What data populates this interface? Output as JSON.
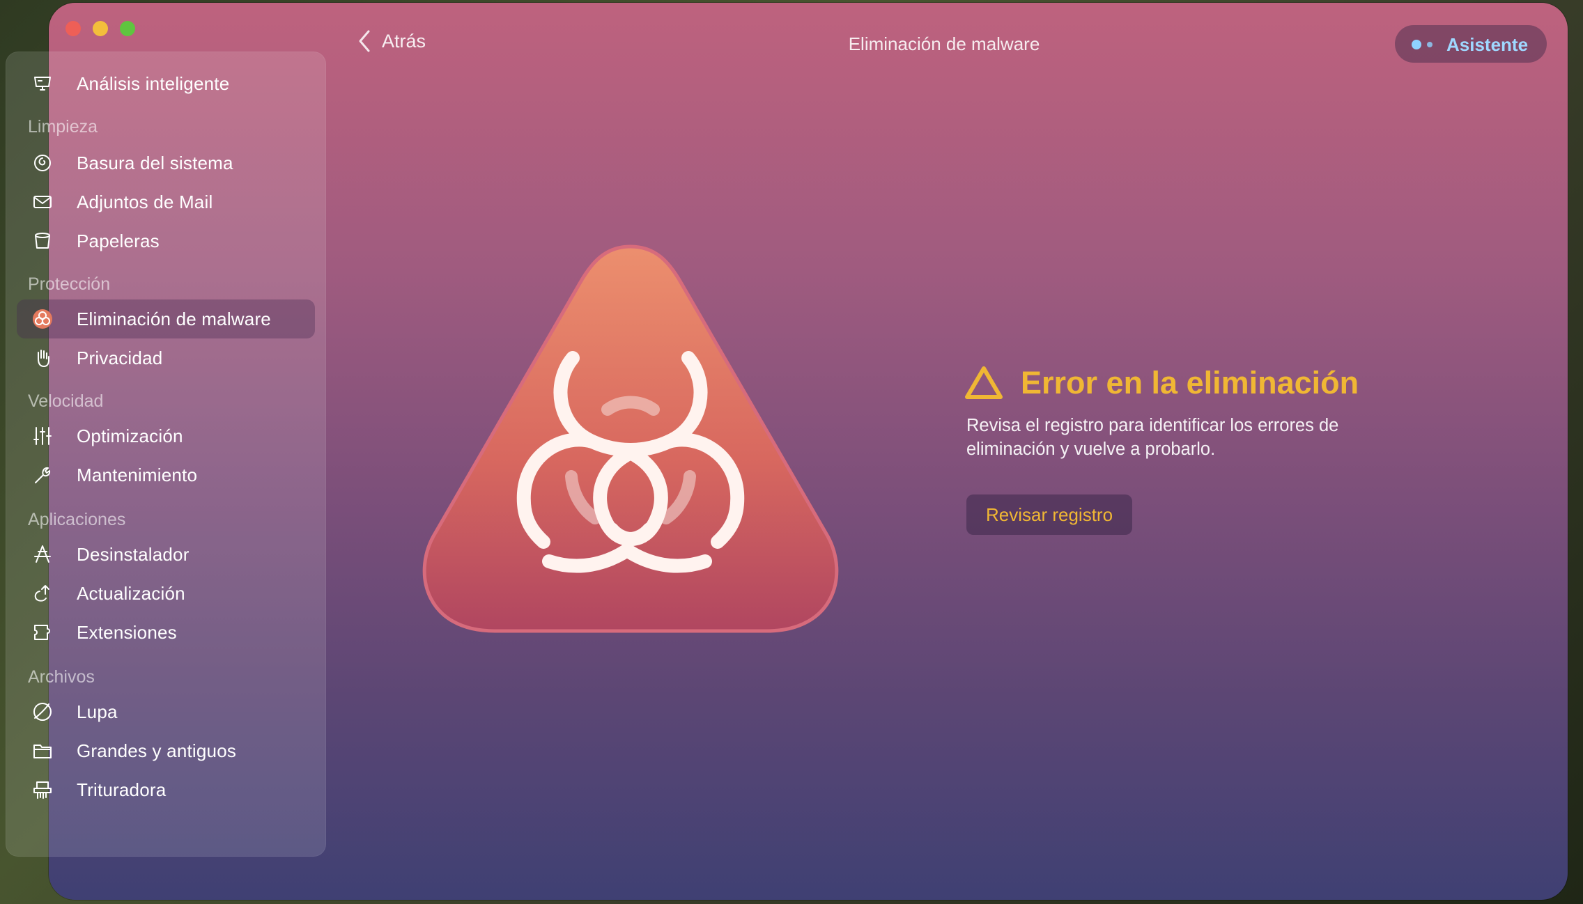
{
  "window": {
    "title": "Eliminación de malware",
    "back_label": "Atrás",
    "assistant_label": "Asistente"
  },
  "sidebar": {
    "top_item": {
      "label": "Análisis inteligente",
      "icon": "monitor-icon"
    },
    "sections": [
      {
        "title": "Limpieza",
        "items": [
          {
            "label": "Basura del sistema",
            "icon": "trash-swirl-icon"
          },
          {
            "label": "Adjuntos de Mail",
            "icon": "envelope-icon"
          },
          {
            "label": "Papeleras",
            "icon": "bin-icon"
          }
        ]
      },
      {
        "title": "Protección",
        "items": [
          {
            "label": "Eliminación de malware",
            "icon": "biohazard-icon",
            "active": true
          },
          {
            "label": "Privacidad",
            "icon": "hand-icon"
          }
        ]
      },
      {
        "title": "Velocidad",
        "items": [
          {
            "label": "Optimización",
            "icon": "sliders-icon"
          },
          {
            "label": "Mantenimiento",
            "icon": "wrench-icon"
          }
        ]
      },
      {
        "title": "Aplicaciones",
        "items": [
          {
            "label": "Desinstalador",
            "icon": "apps-icon"
          },
          {
            "label": "Actualización",
            "icon": "update-arrow-icon"
          },
          {
            "label": "Extensiones",
            "icon": "puzzle-icon"
          }
        ]
      },
      {
        "title": "Archivos",
        "items": [
          {
            "label": "Lupa",
            "icon": "lens-icon"
          },
          {
            "label": "Grandes y antiguos",
            "icon": "folder-icon"
          },
          {
            "label": "Trituradora",
            "icon": "shredder-icon"
          }
        ]
      }
    ]
  },
  "main": {
    "error_title": "Error en la eliminación",
    "error_description": "Revisa el registro para identificar los errores de eliminación y vuelve a probarlo.",
    "review_button": "Revisar registro"
  },
  "colors": {
    "accent_yellow": "#f0b734",
    "assistant_blue": "#9fd8ff",
    "gradient_top": "#be627e",
    "gradient_bottom": "#3f4073"
  }
}
